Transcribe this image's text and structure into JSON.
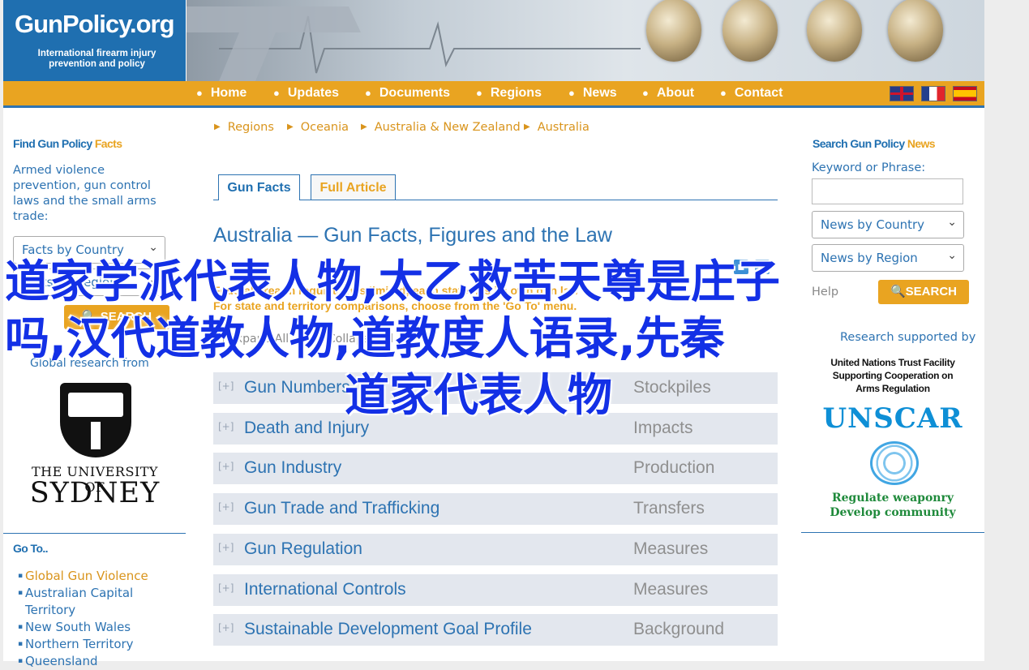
{
  "logo": {
    "title": "GunPolicy.org",
    "subtitle": "International firearm injury prevention and policy"
  },
  "nav": {
    "items": [
      "Home",
      "Updates",
      "Documents",
      "Regions",
      "News",
      "About",
      "Contact"
    ]
  },
  "flags": [
    "uk-flag-icon",
    "france-flag-icon",
    "spain-flag-icon"
  ],
  "left": {
    "title_main": "Find Gun Policy",
    "title_accent": "Facts",
    "description": "Armed violence prevention, gun control laws and the small arms trade:",
    "select_country": "Facts by Country",
    "select_region": "Facts by Region",
    "search_label": "SEARCH",
    "global_label": "Global research from",
    "sydney_top": "THE UNIVERSITY OF",
    "sydney_big": "SYDNEY",
    "goto_title": "Go To..",
    "goto_items": [
      "Global Gun Violence",
      "Australian Capital Territory",
      "New South Wales",
      "Northern Territory",
      "Queensland"
    ]
  },
  "breadcrumb": [
    "Regions",
    "Oceania",
    "Australia & New Zealand",
    "Australia"
  ],
  "tabs": {
    "active": "Gun Facts",
    "inactive": "Full Article"
  },
  "main": {
    "title": "Australia — Gun Facts, Figures and the Law",
    "note1": "Federal firearm regulation is limited; each state has its own gun law",
    "note2": "For state and territory comparisons, choose from the 'Go To' menu.",
    "expand_all": "Expand All",
    "collapse_all": "Collapse All",
    "rows": [
      {
        "label": "Gun Numbers",
        "cat": "Stockpiles"
      },
      {
        "label": "Death and Injury",
        "cat": "Impacts"
      },
      {
        "label": "Gun Industry",
        "cat": "Production"
      },
      {
        "label": "Gun Trade and Trafficking",
        "cat": "Transfers"
      },
      {
        "label": "Gun Regulation",
        "cat": "Measures"
      },
      {
        "label": "International Controls",
        "cat": "Measures"
      },
      {
        "label": "Sustainable Development Goal Profile",
        "cat": "Background"
      }
    ]
  },
  "right": {
    "title_main": "Search Gun Policy",
    "title_accent": "News",
    "keyword_label": "Keyword or Phrase:",
    "keyword_value": "",
    "select_country": "News by Country",
    "select_region": "News by Region",
    "help": "Help",
    "search_label": "SEARCH",
    "supported_by": "Research supported by",
    "un_line1": "United Nations Trust Facility",
    "un_line2": "Supporting Cooperation on",
    "un_line3": "Arms Regulation",
    "unscar": "UNSCAR",
    "green1": "Regulate weaponry",
    "green2": "Develop community"
  },
  "watermark": {
    "line1": "道家学派代表人物,太乙救苦天尊是庄子",
    "line2": "吗,汉代道教人物,道教度人语录,先秦",
    "line3": "道家代表人物"
  }
}
